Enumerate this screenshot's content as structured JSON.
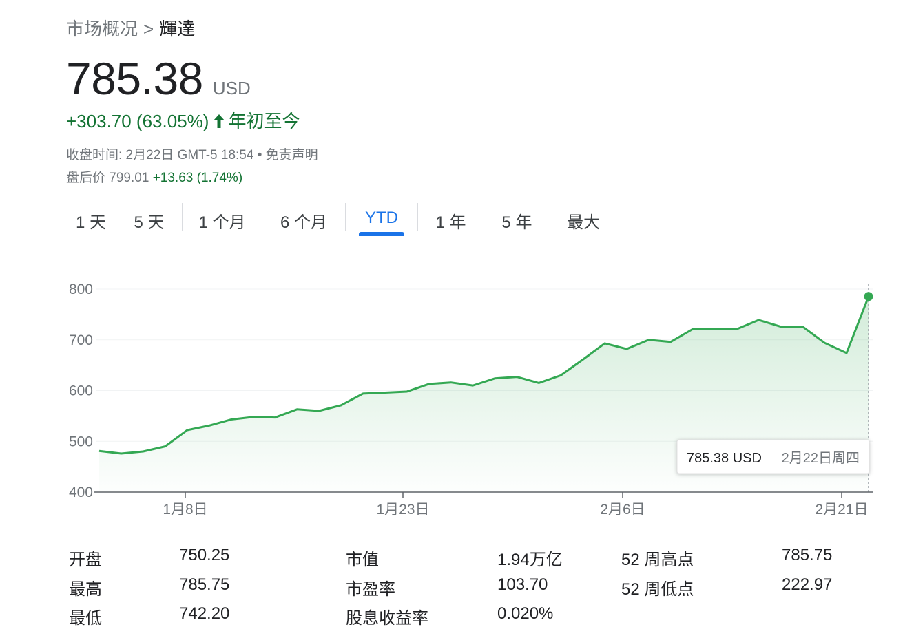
{
  "breadcrumb": {
    "parent": "市场概况",
    "separator": ">",
    "current": "輝達"
  },
  "quote": {
    "price": "785.38",
    "currency": "USD"
  },
  "change": {
    "text": "+303.70 (63.05%)",
    "period": "年初至今"
  },
  "meta": {
    "close_time": "收盘时间: 2月22日 GMT-5 18:54",
    "dot": "•",
    "disclaimer": "免责声明"
  },
  "after_hours": {
    "label": "盘后价",
    "price": "799.01",
    "change": "+13.63 (1.74%)"
  },
  "tabs": [
    "1 天",
    "5 天",
    "1 个月",
    "6 个月",
    "YTD",
    "1 年",
    "5 年",
    "最大"
  ],
  "active_tab": "YTD",
  "colors": {
    "up": "#137333",
    "line": "#34a853",
    "accent": "#1a73e8"
  },
  "chart_data": {
    "type": "area",
    "ylim": [
      400,
      800
    ],
    "yticks": [
      400,
      500,
      600,
      700,
      800
    ],
    "xticks": [
      "1月8日",
      "1月23日",
      "2月6日",
      "2月21日"
    ],
    "series": [
      {
        "values": [
          481,
          476,
          480,
          490,
          522,
          531,
          543,
          548,
          547,
          563,
          560,
          571,
          594,
          596,
          598,
          613,
          616,
          610,
          624,
          627,
          615,
          630,
          661,
          693,
          682,
          700,
          696,
          721,
          722,
          721,
          739,
          726,
          726,
          694,
          674,
          785.38
        ]
      }
    ],
    "tooltip": {
      "value": "785.38 USD",
      "date": "2月22日周四"
    }
  },
  "stats": [
    {
      "label": "开盘",
      "value": "750.25"
    },
    {
      "label": "最高",
      "value": "785.75"
    },
    {
      "label": "最低",
      "value": "742.20"
    },
    {
      "label": "市值",
      "value": "1.94万亿"
    },
    {
      "label": "市盈率",
      "value": "103.70"
    },
    {
      "label": "股息收益率",
      "value": "0.020%"
    },
    {
      "label": "52 周高点",
      "value": "785.75"
    },
    {
      "label": "52 周低点",
      "value": "222.97"
    }
  ]
}
